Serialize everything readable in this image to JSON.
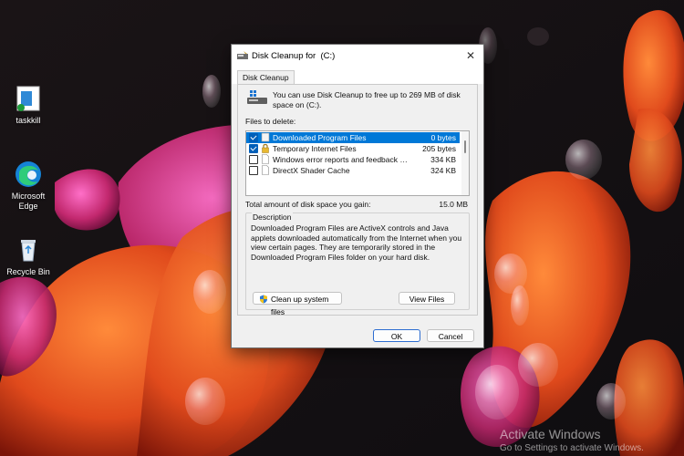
{
  "desktop": {
    "icons": [
      {
        "label": "taskkill",
        "icon": "app-window-icon"
      },
      {
        "label": "Microsoft\nEdge",
        "icon": "edge-icon"
      },
      {
        "label": "Recycle Bin",
        "icon": "recycle-bin-icon"
      }
    ],
    "watermark": {
      "title": "Activate Windows",
      "subtitle": "Go to Settings to activate Windows."
    }
  },
  "dialog": {
    "title": "Disk Cleanup for  (C:)",
    "close_label": "✕",
    "tab": "Disk Cleanup",
    "info": "You can use Disk Cleanup to free up to 269 MB of disk space on  (C:).",
    "files_label": "Files to delete:",
    "files": [
      {
        "name": "Downloaded Program Files",
        "size": "0 bytes",
        "checked": true,
        "selected": true,
        "icon": "folder-icon"
      },
      {
        "name": "Temporary Internet Files",
        "size": "205 bytes",
        "checked": true,
        "selected": false,
        "icon": "lock-icon"
      },
      {
        "name": "Windows error reports and feedback di...",
        "size": "334 KB",
        "checked": false,
        "selected": false,
        "icon": "document-icon"
      },
      {
        "name": "DirectX Shader Cache",
        "size": "324 KB",
        "checked": false,
        "selected": false,
        "icon": "document-icon"
      }
    ],
    "total_label": "Total amount of disk space you gain:",
    "total_value": "15.0 MB",
    "description_title": "Description",
    "description": "Downloaded Program Files are ActiveX controls and Java applets downloaded automatically from the Internet when you view certain pages. They are temporarily stored in the Downloaded Program Files folder on your hard disk.",
    "cleanup_button": "Clean up system files",
    "view_button": "View Files",
    "ok_button": "OK",
    "cancel_button": "Cancel"
  },
  "colors": {
    "selection": "#0078d7",
    "checkbox": "#005fb8"
  }
}
